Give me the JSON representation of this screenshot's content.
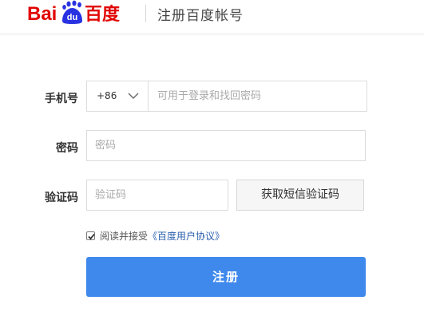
{
  "header": {
    "logo_text_left": "Bai",
    "logo_paw_text": "du",
    "logo_text_right": "百度",
    "title": "注册百度帐号"
  },
  "form": {
    "phone": {
      "label": "手机号",
      "country_code": "+86",
      "placeholder": "可用于登录和找回密码"
    },
    "password": {
      "label": "密码",
      "placeholder": "密码"
    },
    "verify": {
      "label": "验证码",
      "placeholder": "验证码",
      "sms_button": "获取短信验证码"
    },
    "agreement": {
      "checked": true,
      "text": "阅读并接受",
      "link": "《百度用户协议》"
    },
    "submit_label": "注册"
  },
  "colors": {
    "brand_red": "#e10602",
    "brand_blue": "#2932e1",
    "primary_button": "#3f89ec",
    "link": "#2b5fae"
  }
}
